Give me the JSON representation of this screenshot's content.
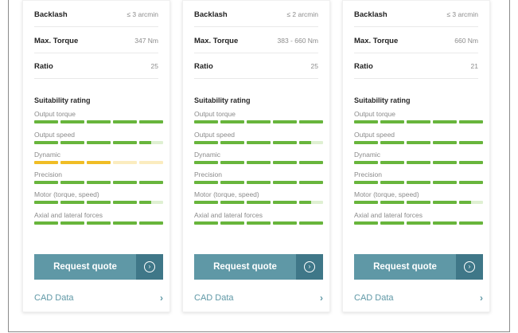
{
  "cards": [
    {
      "specs": [
        {
          "label": "Backlash",
          "value": "≤ 3 arcmin"
        },
        {
          "label": "Max. Torque",
          "value": "347 Nm"
        },
        {
          "label": "Ratio",
          "value": "25"
        }
      ],
      "rating_title": "Suitability rating",
      "ratings": [
        {
          "label": "Output torque",
          "score": 5,
          "color": "#68b53c"
        },
        {
          "label": "Output speed",
          "score": 4.5,
          "color": "#68b53c"
        },
        {
          "label": "Dynamic",
          "score": 3,
          "color": "#f0bd25"
        },
        {
          "label": "Precision",
          "score": 5,
          "color": "#68b53c"
        },
        {
          "label": "Motor (torque, speed)",
          "score": 4.5,
          "color": "#68b53c"
        },
        {
          "label": "Axial and lateral forces",
          "score": 5,
          "color": "#68b53c"
        }
      ],
      "cta_label": "Request quote",
      "cad_label": "CAD Data"
    },
    {
      "specs": [
        {
          "label": "Backlash",
          "value": "≤ 2 arcmin"
        },
        {
          "label": "Max. Torque",
          "value": "383 - 660 Nm"
        },
        {
          "label": "Ratio",
          "value": "25"
        }
      ],
      "rating_title": "Suitability rating",
      "ratings": [
        {
          "label": "Output torque",
          "score": 5,
          "color": "#68b53c"
        },
        {
          "label": "Output speed",
          "score": 4.5,
          "color": "#68b53c"
        },
        {
          "label": "Dynamic",
          "score": 5,
          "color": "#68b53c"
        },
        {
          "label": "Precision",
          "score": 5,
          "color": "#68b53c"
        },
        {
          "label": "Motor (torque, speed)",
          "score": 4.5,
          "color": "#68b53c"
        },
        {
          "label": "Axial and lateral forces",
          "score": 5,
          "color": "#68b53c"
        }
      ],
      "cta_label": "Request quote",
      "cad_label": "CAD Data"
    },
    {
      "specs": [
        {
          "label": "Backlash",
          "value": "≤ 3 arcmin"
        },
        {
          "label": "Max. Torque",
          "value": "660 Nm"
        },
        {
          "label": "Ratio",
          "value": "21"
        }
      ],
      "rating_title": "Suitability rating",
      "ratings": [
        {
          "label": "Output torque",
          "score": 5,
          "color": "#68b53c"
        },
        {
          "label": "Output speed",
          "score": 5,
          "color": "#68b53c"
        },
        {
          "label": "Dynamic",
          "score": 5,
          "color": "#68b53c"
        },
        {
          "label": "Precision",
          "score": 5,
          "color": "#68b53c"
        },
        {
          "label": "Motor (torque, speed)",
          "score": 4.5,
          "color": "#68b53c"
        },
        {
          "label": "Axial and lateral forces",
          "score": 5,
          "color": "#68b53c"
        }
      ],
      "cta_label": "Request quote",
      "cad_label": "CAD Data"
    }
  ],
  "icons": {
    "cta_icon": "arrow-circle-right-icon",
    "cad_icon": "chevron-right-icon"
  }
}
